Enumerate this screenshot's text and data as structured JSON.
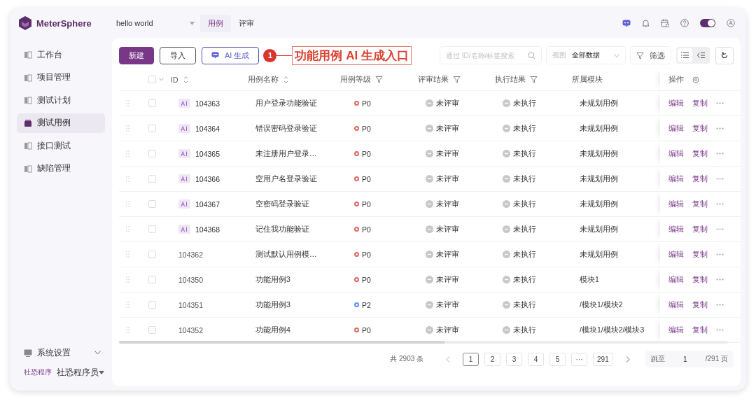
{
  "topbar": {
    "brand": "MeterSphere",
    "project": "hello world",
    "tabs": [
      {
        "label": "用例",
        "selected": true
      },
      {
        "label": "评审",
        "selected": false
      }
    ],
    "switch": {
      "on": true
    }
  },
  "sidebar": {
    "items": [
      {
        "label": "工作台",
        "selected": false
      },
      {
        "label": "项目管理",
        "selected": false
      },
      {
        "label": "测试计划",
        "selected": false
      },
      {
        "label": "测试用例",
        "selected": true
      },
      {
        "label": "接口测试",
        "selected": false
      },
      {
        "label": "缺陷管理",
        "selected": false
      }
    ],
    "settings": {
      "label": "系统设置"
    },
    "user": {
      "avatar_text": "社恐程序",
      "name": "社恐程序员"
    }
  },
  "toolbar": {
    "buttons": [
      {
        "label": "新建",
        "kind": "primary"
      },
      {
        "label": "导入",
        "kind": "default"
      },
      {
        "label": "AI 生成",
        "kind": "ai"
      }
    ],
    "annotation": {
      "number": "1",
      "text": "功能用例 AI 生成入口"
    },
    "search": {
      "placeholder": "通过 ID/名称/标签搜索"
    },
    "view": {
      "label": "视图",
      "value": "全部数据"
    },
    "filter": {
      "label": "筛选"
    },
    "layout_modes": [
      {
        "kind": "list",
        "selected": true
      },
      {
        "kind": "tree",
        "selected": false
      }
    ]
  },
  "table": {
    "columns": [
      {
        "label": "ID",
        "kind": "sort"
      },
      {
        "label": "用例名称",
        "kind": "sort"
      },
      {
        "label": "用例等级",
        "kind": "filter"
      },
      {
        "label": "评审结果",
        "kind": "filter"
      },
      {
        "label": "执行结果",
        "kind": "filter"
      },
      {
        "label": "所属模块",
        "kind": "plain"
      },
      {
        "label": "操作",
        "kind": "settings"
      }
    ],
    "header_checked": false,
    "rows": [
      {
        "checked": false,
        "ai": true,
        "id": "104363",
        "name": "用户登录功能验证",
        "level": "P0",
        "color": "#e0685e",
        "review": "未评审",
        "execution": "未执行",
        "module": "未规划用例",
        "actions": [
          "编辑",
          "复制"
        ]
      },
      {
        "checked": false,
        "ai": true,
        "id": "104364",
        "name": "错误密码登录验证",
        "level": "P0",
        "color": "#e0685e",
        "review": "未评审",
        "execution": "未执行",
        "module": "未规划用例",
        "actions": [
          "编辑",
          "复制"
        ]
      },
      {
        "checked": false,
        "ai": true,
        "id": "104365",
        "name": "未注册用户登录…",
        "level": "P0",
        "color": "#e0685e",
        "review": "未评审",
        "execution": "未执行",
        "module": "未规划用例",
        "actions": [
          "编辑",
          "复制"
        ]
      },
      {
        "checked": false,
        "ai": true,
        "id": "104366",
        "name": "空用户名登录验证",
        "level": "P0",
        "color": "#e0685e",
        "review": "未评审",
        "execution": "未执行",
        "module": "未规划用例",
        "actions": [
          "编辑",
          "复制"
        ]
      },
      {
        "checked": false,
        "ai": true,
        "id": "104367",
        "name": "空密码登录验证",
        "level": "P0",
        "color": "#e0685e",
        "review": "未评审",
        "execution": "未执行",
        "module": "未规划用例",
        "actions": [
          "编辑",
          "复制"
        ]
      },
      {
        "checked": false,
        "ai": true,
        "id": "104368",
        "name": "记住我功能验证",
        "level": "P0",
        "color": "#e0685e",
        "review": "未评审",
        "execution": "未执行",
        "module": "未规划用例",
        "actions": [
          "编辑",
          "复制"
        ]
      },
      {
        "checked": false,
        "ai": false,
        "id": "104362",
        "name": "测试默认用例模…",
        "level": "P0",
        "color": "#e0685e",
        "review": "未评审",
        "execution": "未执行",
        "module": "未规划用例",
        "actions": [
          "编辑",
          "复制"
        ]
      },
      {
        "checked": false,
        "ai": false,
        "id": "104350",
        "name": "功能用例3",
        "level": "P0",
        "color": "#e0685e",
        "review": "未评审",
        "execution": "未执行",
        "module": "模块1",
        "actions": [
          "编辑",
          "复制"
        ]
      },
      {
        "checked": false,
        "ai": false,
        "id": "104351",
        "name": "功能用例3",
        "level": "P2",
        "color": "#5b8ff9",
        "review": "未评审",
        "execution": "未执行",
        "module": "/模块1/模块2",
        "actions": [
          "编辑",
          "复制"
        ]
      },
      {
        "checked": false,
        "ai": false,
        "id": "104352",
        "name": "功能用例4",
        "level": "P0",
        "color": "#e0685e",
        "review": "未评审",
        "execution": "未执行",
        "module": "/模块1/模块2/模块3",
        "actions": [
          "编辑",
          "复制"
        ]
      }
    ]
  },
  "pagination": {
    "total": "共 2903 条",
    "pages": [
      {
        "label": "1",
        "selected": true
      },
      {
        "label": "2",
        "selected": false
      },
      {
        "label": "3",
        "selected": false
      },
      {
        "label": "4",
        "selected": false
      },
      {
        "label": "5",
        "selected": false
      },
      {
        "label": "···",
        "selected": false
      },
      {
        "label": "291",
        "selected": false
      }
    ],
    "jump_label": "跳至",
    "jump_value": "1",
    "page_count": "/291 页"
  }
}
